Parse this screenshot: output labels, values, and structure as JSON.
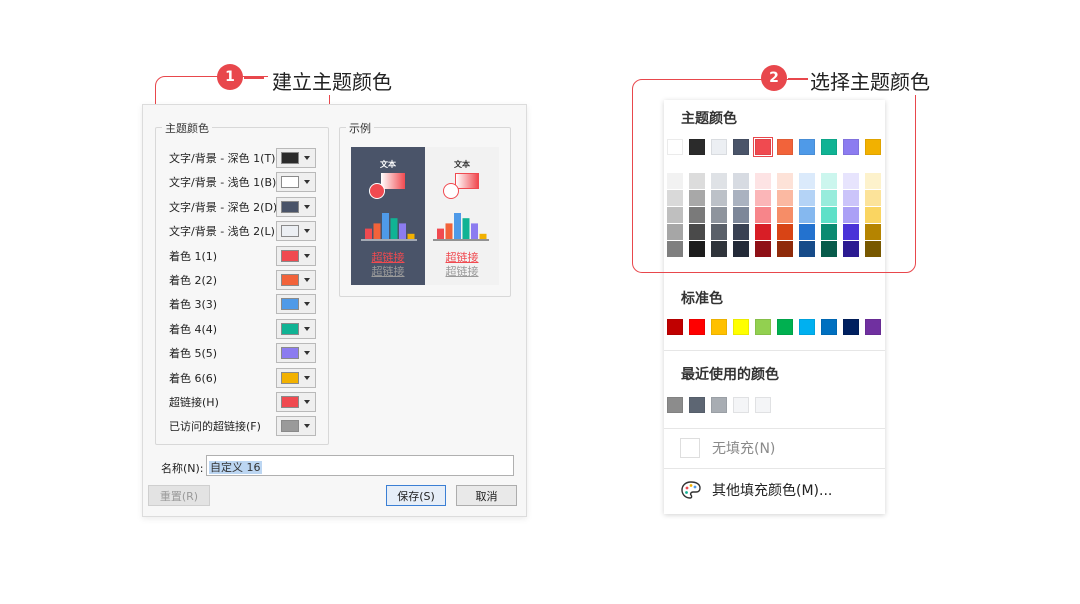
{
  "callouts": [
    {
      "number": "1",
      "title": "建立主题颜色"
    },
    {
      "number": "2",
      "title": "选择主题颜色"
    }
  ],
  "dialog": {
    "theme_colors_group": "主题颜色",
    "preview_group": "示例",
    "rows": [
      {
        "label": "文字/背景 - 深色 1(T)",
        "color": "#2b2b2b"
      },
      {
        "label": "文字/背景 - 浅色 1(B)",
        "color": "#ffffff"
      },
      {
        "label": "文字/背景 - 深色 2(D)",
        "color": "#4a5469"
      },
      {
        "label": "文字/背景 - 浅色 2(L)",
        "color": "#eceff3"
      },
      {
        "label": "着色 1(1)",
        "color": "#f04a50"
      },
      {
        "label": "着色 2(2)",
        "color": "#f2633a"
      },
      {
        "label": "着色 3(3)",
        "color": "#4f9ae8"
      },
      {
        "label": "着色 4(4)",
        "color": "#10b394"
      },
      {
        "label": "着色 5(5)",
        "color": "#8c7cf0"
      },
      {
        "label": "着色 6(6)",
        "color": "#f2b100"
      },
      {
        "label": "超链接(H)",
        "color": "#f04a50"
      },
      {
        "label": "已访问的超链接(F)",
        "color": "#9a9a9a"
      }
    ],
    "preview": {
      "text_label": "文本",
      "hyperlink": "超链接",
      "visited": "超链接",
      "bars": [
        {
          "value": 2,
          "color": "#f04a50"
        },
        {
          "value": 3,
          "color": "#f2633a"
        },
        {
          "value": 5,
          "color": "#4f9ae8"
        },
        {
          "value": 4,
          "color": "#10b394"
        },
        {
          "value": 3,
          "color": "#8c7cf0"
        },
        {
          "value": 1,
          "color": "#f2b100"
        }
      ]
    },
    "name_label": "名称(N):",
    "name_value": "自定义 16",
    "reset_button": "重置(R)",
    "save_button": "保存(S)",
    "cancel_button": "取消"
  },
  "panel": {
    "theme_title": "主题颜色",
    "theme_colors": [
      "#ffffff",
      "#2b2b2b",
      "#eceff3",
      "#4a5469",
      "#f04a50",
      "#f2633a",
      "#4f9ae8",
      "#10b394",
      "#8c7cf0",
      "#f2b100"
    ],
    "shades": [
      [
        "#f2f2f2",
        "#d9d9d9",
        "#bfbfbf",
        "#a6a6a6",
        "#7f7f7f"
      ],
      [
        "#dcdcdc",
        "#a8a8a8",
        "#7a7a7a",
        "#4a4a4a",
        "#1c1c1c"
      ],
      [
        "#dfe2e6",
        "#bcc1c8",
        "#8e949d",
        "#5a6069",
        "#2f343b"
      ],
      [
        "#d7dbe2",
        "#aab2c0",
        "#7d8799",
        "#394153",
        "#232a38"
      ],
      [
        "#fde3e4",
        "#fbb6b8",
        "#f7858a",
        "#d81e26",
        "#8f1016"
      ],
      [
        "#fde2d8",
        "#fbb9a2",
        "#f68d67",
        "#d84415",
        "#8f2a0a"
      ],
      [
        "#dbeafb",
        "#b4d3f6",
        "#85b8ef",
        "#2372cf",
        "#164b89"
      ],
      [
        "#ccf6ee",
        "#97ecdc",
        "#5ee0c8",
        "#0b8a71",
        "#075b4b"
      ],
      [
        "#e7e4fd",
        "#cbc4fa",
        "#aba0f6",
        "#4a33d8",
        "#2c1b92"
      ],
      [
        "#fdf2cc",
        "#fce39a",
        "#fad561",
        "#b58400",
        "#785800"
      ]
    ],
    "standard_title": "标准色",
    "standard_colors": [
      "#c00000",
      "#ff0000",
      "#ffc000",
      "#ffff00",
      "#92d050",
      "#00b050",
      "#00b0f0",
      "#0070c0",
      "#002060",
      "#7030a0"
    ],
    "recent_title": "最近使用的颜色",
    "recent_colors": [
      "#8c8c8c",
      "#5d6673",
      "#a8adb3",
      "#f4f5f7",
      "#f4f5f7"
    ],
    "no_fill": "无填充(N)",
    "more_colors": "其他填充颜色(M)..."
  }
}
